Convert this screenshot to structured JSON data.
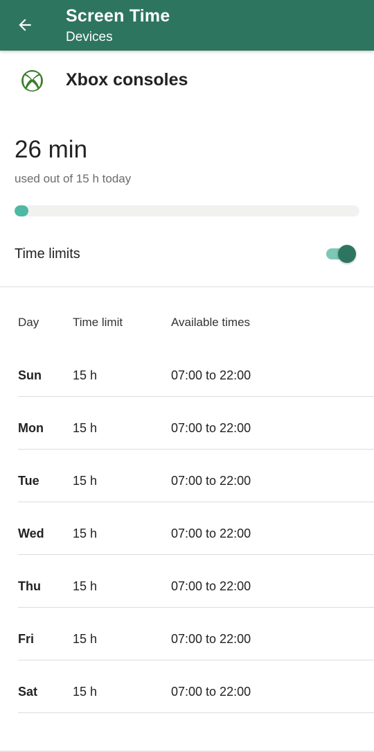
{
  "app_bar": {
    "title": "Screen Time",
    "subtitle": "Devices",
    "back_icon": "arrow-left-icon",
    "color": "#2e7560"
  },
  "device": {
    "name": "Xbox consoles",
    "icon": "xbox-logo-icon",
    "icon_color": "#3a7d2c"
  },
  "usage": {
    "value": "26 min",
    "caption": "used out of 15 h today",
    "progress_fraction": 0.029,
    "accent": "#4fb8a3"
  },
  "time_limits": {
    "label": "Time limits",
    "enabled": true
  },
  "schedule": {
    "headers": {
      "day": "Day",
      "limit": "Time limit",
      "times": "Available times"
    },
    "rows": [
      {
        "day": "Sun",
        "limit": "15 h",
        "times": "07:00 to 22:00"
      },
      {
        "day": "Mon",
        "limit": "15 h",
        "times": "07:00 to 22:00"
      },
      {
        "day": "Tue",
        "limit": "15 h",
        "times": "07:00 to 22:00"
      },
      {
        "day": "Wed",
        "limit": "15 h",
        "times": "07:00 to 22:00"
      },
      {
        "day": "Thu",
        "limit": "15 h",
        "times": "07:00 to 22:00"
      },
      {
        "day": "Fri",
        "limit": "15 h",
        "times": "07:00 to 22:00"
      },
      {
        "day": "Sat",
        "limit": "15 h",
        "times": "07:00 to 22:00"
      }
    ]
  }
}
